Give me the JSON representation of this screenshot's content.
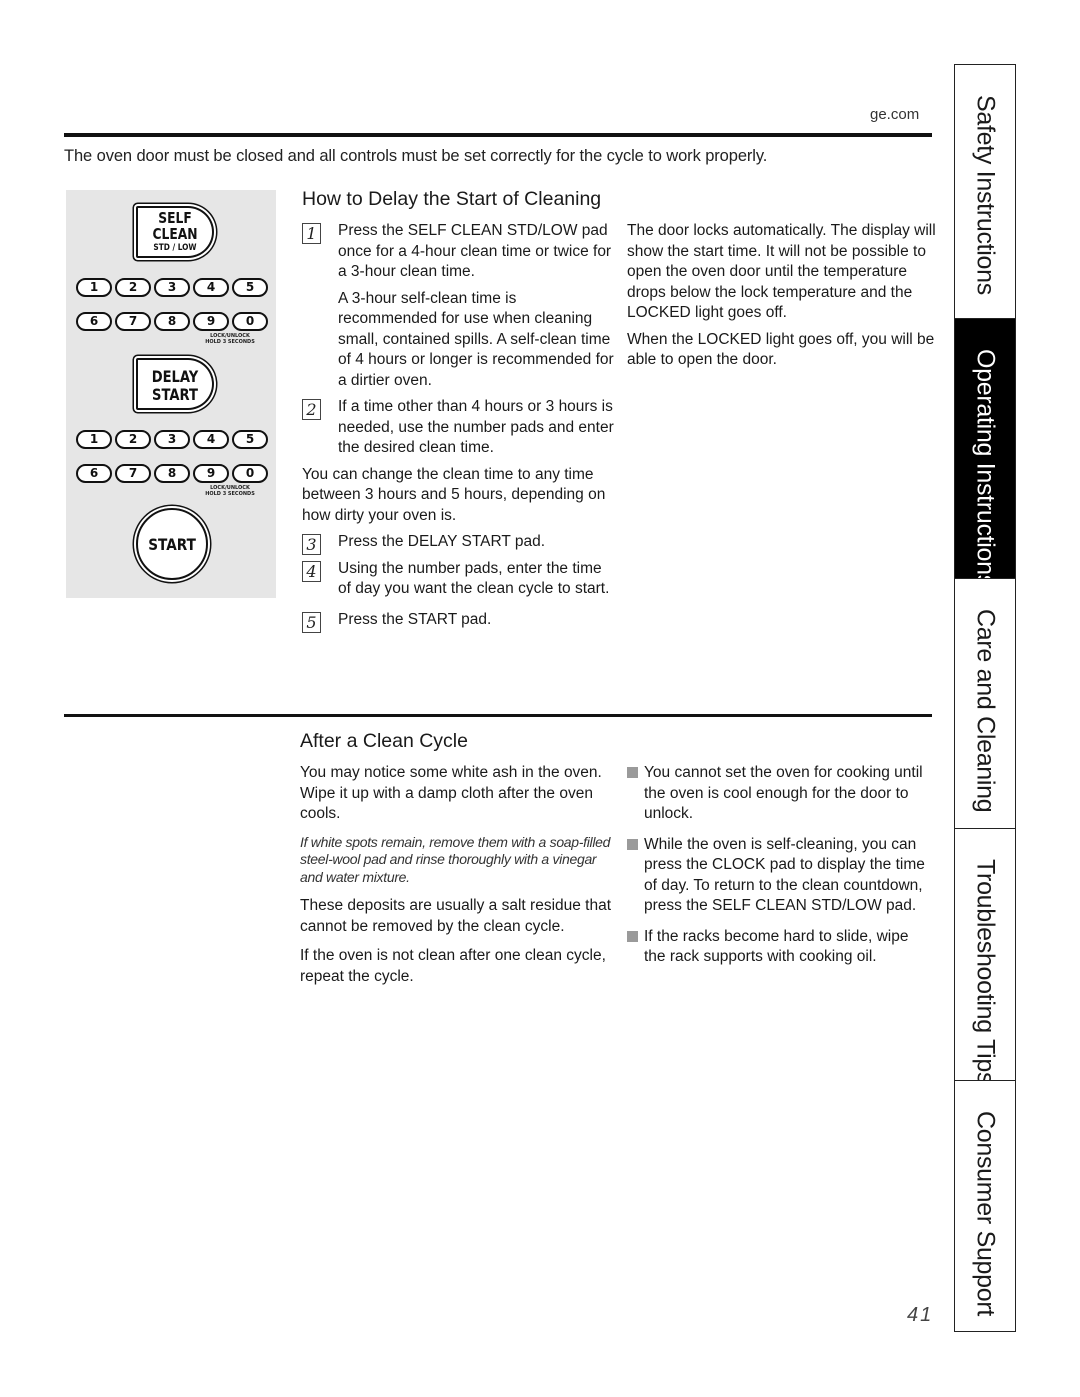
{
  "header": {
    "site": "ge.com",
    "intro": "The oven door must be closed and all controls must be set correctly for the cycle to work properly."
  },
  "control_panel": {
    "self_clean_pad": {
      "line1": "SELF",
      "line2": "CLEAN",
      "line3": "STD / LOW"
    },
    "delay_start_pad": {
      "line1": "DELAY",
      "line2": "START"
    },
    "number_row_1": [
      "1",
      "2",
      "3",
      "4",
      "5"
    ],
    "number_row_2": [
      "6",
      "7",
      "8",
      "9",
      "0"
    ],
    "lock_label_1": "LOCK/UNLOCK",
    "lock_label_2": "HOLD 3 SECONDS",
    "start_pad": "START"
  },
  "delay_section": {
    "title": "How to Delay the Start of Cleaning",
    "steps": [
      {
        "num": "1",
        "text": "Press the SELF CLEAN STD/LOW pad once for a 4-hour clean time or twice for a 3-hour clean time."
      },
      {
        "num": "2",
        "text": "If a time other than 4 hours or 3 hours is needed, use the number pads and enter the desired clean time."
      },
      {
        "num": "3",
        "text": "Press the DELAY START pad."
      },
      {
        "num": "4",
        "text": "Using the number pads, enter the time of day you want the clean cycle to start."
      },
      {
        "num": "5",
        "text": "Press the START pad."
      }
    ],
    "step1_note": "A 3-hour self-clean time is recommended for use when cleaning small, contained spills. A self-clean time of 4 hours or longer is recommended for a dirtier oven.",
    "change_note": "You can change the clean time to any time between 3 hours and 5 hours, depending on how dirty your oven is.",
    "right_para_1": "The door locks automatically. The display will show the start time. It will not be possible to open the oven door until the temperature drops below the lock temperature and the LOCKED light goes off.",
    "right_para_2": "When the LOCKED light goes off, you will be able to open the door."
  },
  "after_section": {
    "title": "After a Clean Cycle",
    "para_1": "You may notice some white ash in the oven. Wipe it up with a damp cloth after the oven cools.",
    "italic_note": "If white spots remain, remove them with a soap-filled steel-wool pad and rinse thoroughly with a vinegar and water mixture.",
    "para_2": "These deposits are usually a salt residue that cannot be removed by the clean cycle.",
    "para_3": "If the oven is not clean after one clean cycle, repeat the cycle.",
    "bullets": [
      "You cannot set the oven for cooking until the oven is cool enough for the door to unlock.",
      "While the oven is self-cleaning, you can press the CLOCK pad to display the time of day. To return to the clean countdown, press the SELF CLEAN STD/LOW pad.",
      "If the racks become hard to slide, wipe the rack supports with cooking oil."
    ]
  },
  "side_tabs": [
    {
      "label": "Safety Instructions",
      "active": false
    },
    {
      "label": "Operating Instructions",
      "active": true
    },
    {
      "label": "Care and Cleaning",
      "active": false
    },
    {
      "label": "Troubleshooting Tips",
      "active": false
    },
    {
      "label": "Consumer Support",
      "active": false
    }
  ],
  "footer": {
    "page_number": "41"
  }
}
